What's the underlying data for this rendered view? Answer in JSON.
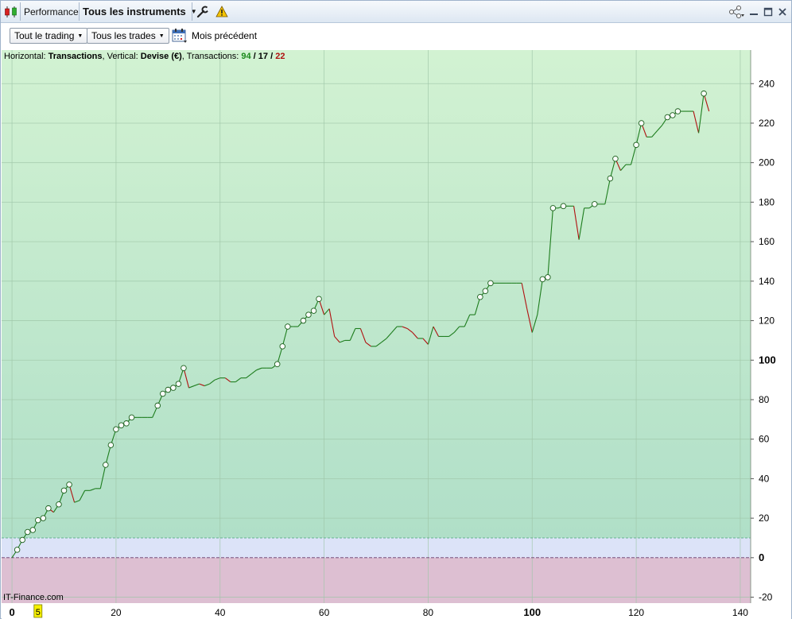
{
  "titlebar": {
    "performance_label": "Performance",
    "instruments_label": "Tous les instruments"
  },
  "toolbar": {
    "trading_filter": "Tout le trading",
    "trades_filter": "Tous les trades",
    "period_label": "Mois précédent"
  },
  "header": {
    "horizontal_prefix": "Horizontal: ",
    "horizontal_value": "Transactions",
    "vertical_prefix": ", Vertical: ",
    "vertical_value": "Devise (€)",
    "transactions_prefix": ", Transactions: ",
    "winning": "94",
    "neutral": "17",
    "losing": "22",
    "slash": " / "
  },
  "watermark": "IT-Finance.com",
  "colors": {
    "up_line": "#1e7d1e",
    "down_line": "#b01010",
    "positive_bg_top": "#d2f2d2",
    "positive_bg_bottom": "#b0dfc8",
    "buffer_band": "#dce3f8",
    "negative_bg": "#ddbfd2"
  },
  "chart_data": {
    "type": "line",
    "xlabel": "",
    "ylabel": "",
    "xlim": [
      -2,
      142
    ],
    "ylim": [
      -23,
      257
    ],
    "x_ticks": [
      "0",
      "20",
      "40",
      "60",
      "80",
      "100",
      "120",
      "140"
    ],
    "x_ticks_bold": [
      "0",
      "100"
    ],
    "highlight_tick": "5",
    "y_ticks": [
      "-20",
      "0",
      "20",
      "40",
      "60",
      "80",
      "100",
      "120",
      "140",
      "160",
      "180",
      "200",
      "220",
      "240"
    ],
    "y_ticks_bold": [
      "0",
      "100"
    ],
    "zero_line": 0,
    "buffer_line": 10,
    "grid": true,
    "series": [
      {
        "values": [
          [
            0,
            0
          ],
          [
            1,
            4
          ],
          [
            2,
            9
          ],
          [
            3,
            13
          ],
          [
            4,
            14
          ],
          [
            5,
            19
          ],
          [
            6,
            20
          ],
          [
            7,
            25
          ],
          [
            8,
            23
          ],
          [
            9,
            27
          ],
          [
            10,
            34
          ],
          [
            11,
            37
          ],
          [
            12,
            28
          ],
          [
            13,
            29
          ],
          [
            14,
            34
          ],
          [
            15,
            34
          ],
          [
            16,
            35
          ],
          [
            17,
            35
          ],
          [
            18,
            47
          ],
          [
            19,
            57
          ],
          [
            20,
            65
          ],
          [
            21,
            67
          ],
          [
            22,
            68
          ],
          [
            23,
            71
          ],
          [
            24,
            71
          ],
          [
            25,
            71
          ],
          [
            26,
            71
          ],
          [
            27,
            71
          ],
          [
            28,
            77
          ],
          [
            29,
            83
          ],
          [
            30,
            85
          ],
          [
            31,
            86
          ],
          [
            32,
            88
          ],
          [
            33,
            96
          ],
          [
            34,
            86
          ],
          [
            35,
            87
          ],
          [
            36,
            88
          ],
          [
            37,
            87
          ],
          [
            38,
            88
          ],
          [
            39,
            90
          ],
          [
            40,
            91
          ],
          [
            41,
            91
          ],
          [
            42,
            89
          ],
          [
            43,
            89
          ],
          [
            44,
            91
          ],
          [
            45,
            91
          ],
          [
            46,
            93
          ],
          [
            47,
            95
          ],
          [
            48,
            96
          ],
          [
            49,
            96
          ],
          [
            50,
            96
          ],
          [
            51,
            98
          ],
          [
            52,
            107
          ],
          [
            53,
            117
          ],
          [
            54,
            117
          ],
          [
            55,
            117
          ],
          [
            56,
            120
          ],
          [
            57,
            123
          ],
          [
            58,
            125
          ],
          [
            59,
            131
          ],
          [
            60,
            123
          ],
          [
            61,
            126
          ],
          [
            62,
            112
          ],
          [
            63,
            109
          ],
          [
            64,
            110
          ],
          [
            65,
            110
          ],
          [
            66,
            116
          ],
          [
            67,
            116
          ],
          [
            68,
            109
          ],
          [
            69,
            107
          ],
          [
            70,
            107
          ],
          [
            71,
            109
          ],
          [
            72,
            111
          ],
          [
            73,
            114
          ],
          [
            74,
            117
          ],
          [
            75,
            117
          ],
          [
            76,
            116
          ],
          [
            77,
            114
          ],
          [
            78,
            111
          ],
          [
            79,
            111
          ],
          [
            80,
            108
          ],
          [
            81,
            117
          ],
          [
            82,
            112
          ],
          [
            83,
            112
          ],
          [
            84,
            112
          ],
          [
            85,
            114
          ],
          [
            86,
            117
          ],
          [
            87,
            117
          ],
          [
            88,
            123
          ],
          [
            89,
            123
          ],
          [
            90,
            132
          ],
          [
            91,
            135
          ],
          [
            92,
            139
          ],
          [
            93,
            139
          ],
          [
            94,
            139
          ],
          [
            95,
            139
          ],
          [
            96,
            139
          ],
          [
            97,
            139
          ],
          [
            98,
            139
          ],
          [
            99,
            126
          ],
          [
            100,
            114
          ],
          [
            101,
            123
          ],
          [
            102,
            141
          ],
          [
            103,
            142
          ],
          [
            104,
            177
          ],
          [
            105,
            177
          ],
          [
            106,
            178
          ],
          [
            107,
            178
          ],
          [
            108,
            178
          ],
          [
            109,
            161
          ],
          [
            110,
            177
          ],
          [
            111,
            177
          ],
          [
            112,
            179
          ],
          [
            113,
            179
          ],
          [
            114,
            179
          ],
          [
            115,
            192
          ],
          [
            116,
            202
          ],
          [
            117,
            196
          ],
          [
            118,
            199
          ],
          [
            119,
            199
          ],
          [
            120,
            209
          ],
          [
            121,
            220
          ],
          [
            122,
            213
          ],
          [
            123,
            213
          ],
          [
            124,
            216
          ],
          [
            125,
            219
          ],
          [
            126,
            223
          ],
          [
            127,
            224
          ],
          [
            128,
            226
          ],
          [
            129,
            226
          ],
          [
            130,
            226
          ],
          [
            131,
            226
          ],
          [
            132,
            215
          ],
          [
            133,
            235
          ],
          [
            134,
            226
          ]
        ]
      }
    ]
  }
}
